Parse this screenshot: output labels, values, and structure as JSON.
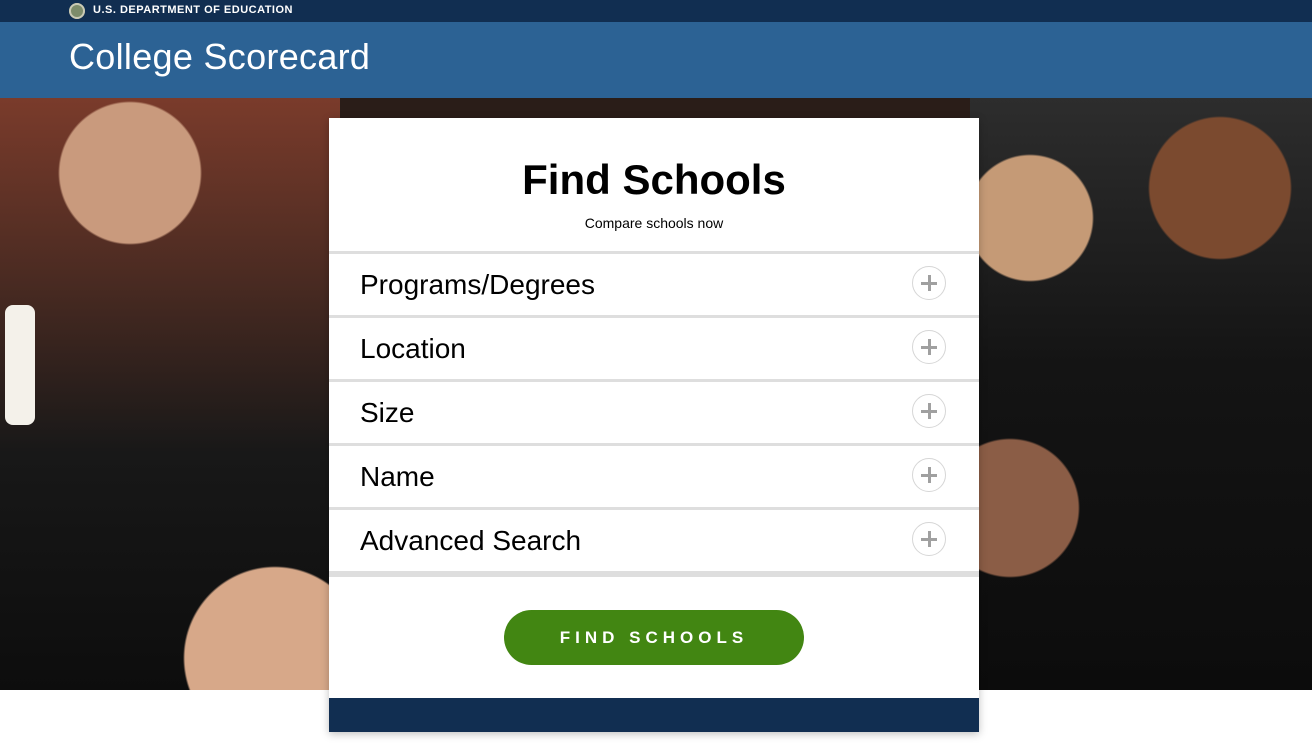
{
  "gov_banner": {
    "seal_icon": "education-seal-icon",
    "label": "U.S. DEPARTMENT OF EDUCATION"
  },
  "header": {
    "site_title": "College Scorecard"
  },
  "search": {
    "title": "Find Schools",
    "subtitle": "Compare schools now",
    "sections": [
      {
        "label": "Programs/Degrees",
        "icon": "plus-icon"
      },
      {
        "label": "Location",
        "icon": "plus-icon"
      },
      {
        "label": "Size",
        "icon": "plus-icon"
      },
      {
        "label": "Name",
        "icon": "plus-icon"
      },
      {
        "label": "Advanced Search",
        "icon": "plus-icon"
      }
    ],
    "submit_label": "FIND SCHOOLS"
  },
  "colors": {
    "gov_bar": "#112e51",
    "brand_bar": "#2c6294",
    "button": "#428612",
    "divider": "#dedede"
  }
}
